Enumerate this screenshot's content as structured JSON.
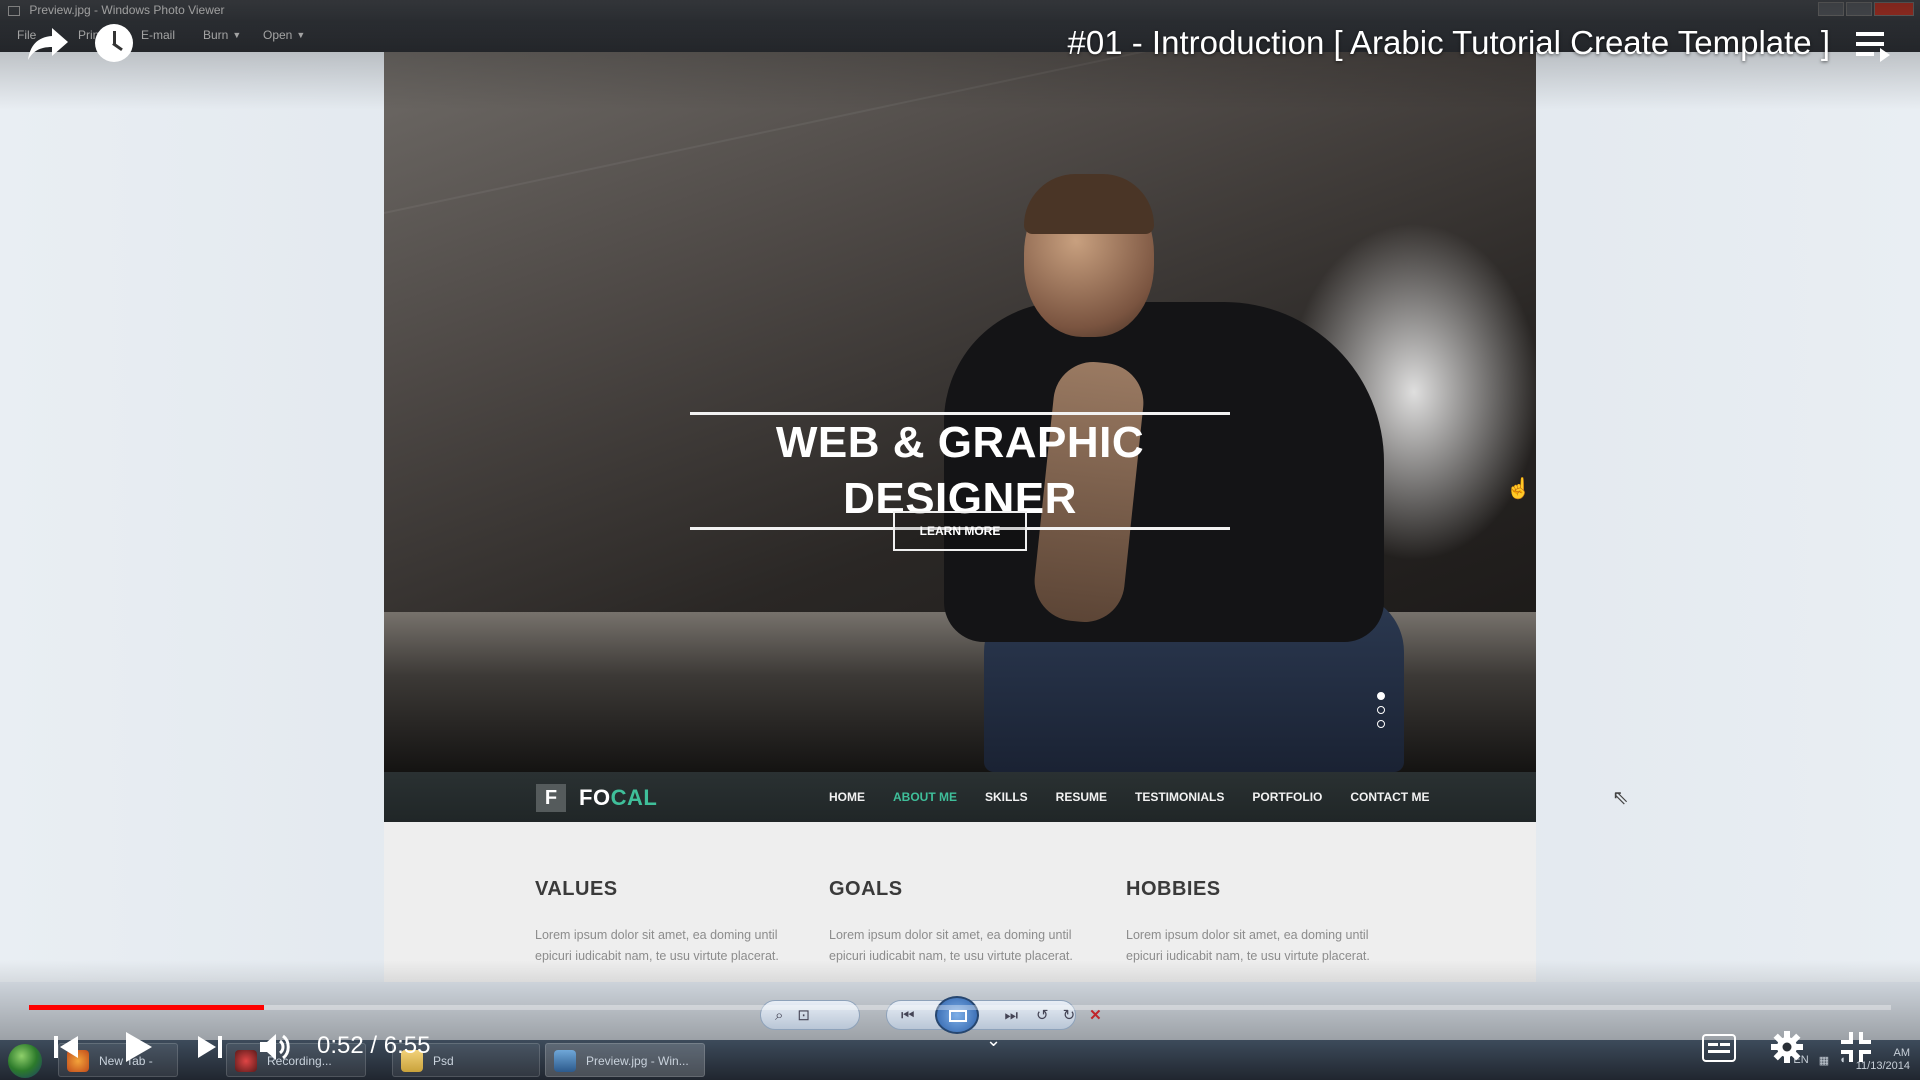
{
  "window": {
    "title": "Preview.jpg - Windows Photo Viewer",
    "menu": [
      "File",
      "Print",
      "E-mail",
      "Burn",
      "Open"
    ]
  },
  "youtube": {
    "video_title": "#01 - Introduction [ Arabic Tutorial Create Template ]",
    "time_display": "0:52 / 6:55",
    "progress_fraction": 0.126
  },
  "site": {
    "hero_title": "WEB & GRAPHIC DESIGNER",
    "hero_button": "LEARN MORE",
    "logo_letter": "F",
    "logo_part1": "FO",
    "logo_part2": "CAL",
    "nav": [
      "HOME",
      "ABOUT ME",
      "SKILLS",
      "RESUME",
      "TESTIMONIALS",
      "PORTFOLIO",
      "CONTACT ME"
    ],
    "nav_active": "ABOUT ME",
    "columns": [
      {
        "heading": "VALUES",
        "text": "Lorem ipsum dolor sit amet, ea doming until epicuri iudicabit nam, te usu virtute placerat."
      },
      {
        "heading": "GOALS",
        "text": "Lorem ipsum dolor sit amet, ea doming until epicuri iudicabit nam, te usu virtute placerat."
      },
      {
        "heading": "HOBBIES",
        "text": "Lorem ipsum dolor sit amet, ea doming until epicuri iudicabit nam, te usu virtute placerat."
      }
    ]
  },
  "taskbar": {
    "tasks": [
      "New Tab - Mozil...",
      "Recording...",
      "Psd",
      "Preview.jpg - Win..."
    ],
    "lang": "EN",
    "clock_time": "AM",
    "clock_date": "11/13/2014"
  },
  "colors": {
    "accent": "#3fbf9a",
    "progress": "#ff0000"
  }
}
